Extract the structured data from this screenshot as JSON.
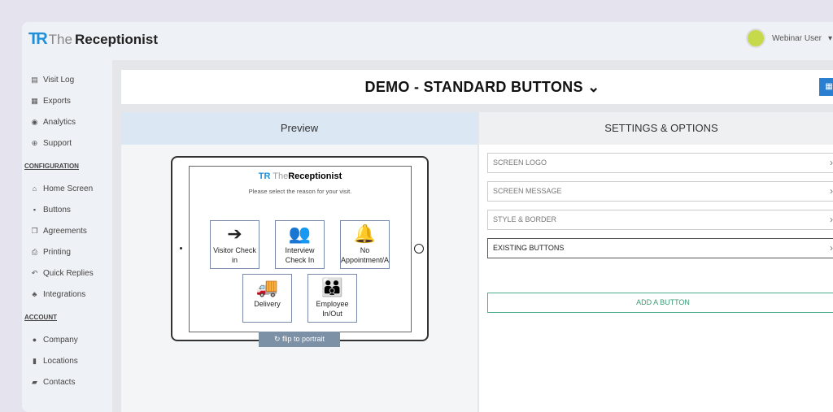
{
  "app": {
    "logo_mark": "TR",
    "logo_the": "The",
    "logo_name": "Receptionist",
    "user_name": "Webinar User",
    "user_caret": "▾"
  },
  "sidebar": {
    "items_top": [
      {
        "label": "Visit Log",
        "icon": "▤"
      },
      {
        "label": "Exports",
        "icon": "▦"
      },
      {
        "label": "Analytics",
        "icon": "◉"
      },
      {
        "label": "Support",
        "icon": "⊕"
      }
    ],
    "config_heading": "CONFIGURATION",
    "items_config": [
      {
        "label": "Home Screen",
        "icon": "⌂"
      },
      {
        "label": "Buttons",
        "icon": "▪"
      },
      {
        "label": "Agreements",
        "icon": "❐"
      },
      {
        "label": "Printing",
        "icon": "⎙"
      },
      {
        "label": "Quick Replies",
        "icon": "↶"
      },
      {
        "label": "Integrations",
        "icon": "♣"
      }
    ],
    "account_heading": "ACCOUNT",
    "items_account": [
      {
        "label": "Company",
        "icon": "●"
      },
      {
        "label": "Locations",
        "icon": "▮"
      },
      {
        "label": "Contacts",
        "icon": "▰"
      }
    ]
  },
  "header": {
    "title": "DEMO - STANDARD BUTTONS",
    "chevron": "⌄",
    "qr_icon": "▦"
  },
  "preview": {
    "heading": "Preview",
    "message": "Please select the reason for your visit.",
    "buttons": [
      {
        "label": "Visitor Check in",
        "glyph": "➔"
      },
      {
        "label": "Interview Check In",
        "glyph": "👥"
      },
      {
        "label": "No Appointment/Assistance",
        "glyph": "🔔"
      },
      {
        "label": "Delivery",
        "glyph": "🚚"
      },
      {
        "label": "Employee In/Out",
        "glyph": "👪"
      }
    ],
    "flip_label": "↻ flip to portrait"
  },
  "settings": {
    "heading": "SETTINGS & OPTIONS",
    "rows": [
      "SCREEN LOGO",
      "SCREEN MESSAGE",
      "STYLE & BORDER",
      "EXISTING BUTTONS"
    ],
    "chevron": "›",
    "add_button": "ADD A BUTTON"
  },
  "colors": {
    "accent": "#2b7fd0",
    "add_button": "#3a9a74",
    "preview_header": "#dce7f4"
  }
}
